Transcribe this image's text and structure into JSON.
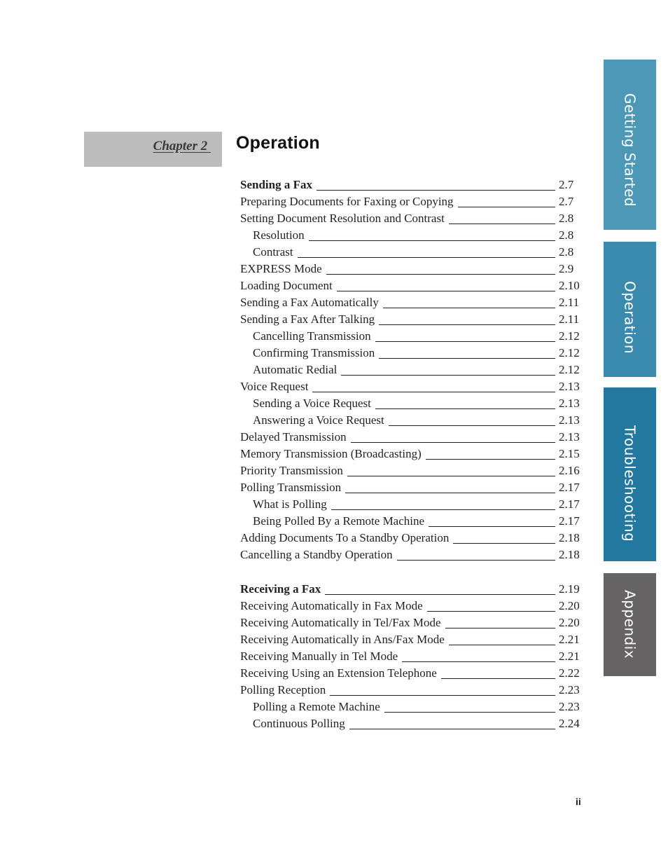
{
  "chapter": {
    "label": "Chapter 2 ",
    "title": "Operation"
  },
  "toc": [
    {
      "text": "Sending a Fax",
      "page": "2.7",
      "level": 0,
      "bold": true
    },
    {
      "text": "Preparing Documents for Faxing or Copying",
      "page": "2.7",
      "level": 0,
      "bold": false
    },
    {
      "text": "Setting Document Resolution and Contrast",
      "page": "2.8",
      "level": 0,
      "bold": false
    },
    {
      "text": "Resolution",
      "page": "2.8",
      "level": 1,
      "bold": false
    },
    {
      "text": "Contrast",
      "page": "2.8",
      "level": 1,
      "bold": false
    },
    {
      "text": "EXPRESS Mode",
      "page": "2.9",
      "level": 0,
      "bold": false
    },
    {
      "text": "Loading Document",
      "page": "2.10",
      "level": 0,
      "bold": false
    },
    {
      "text": "Sending a Fax Automatically",
      "page": "2.11",
      "level": 0,
      "bold": false
    },
    {
      "text": "Sending a Fax After Talking",
      "page": "2.11",
      "level": 0,
      "bold": false
    },
    {
      "text": "Cancelling Transmission",
      "page": "2.12",
      "level": 1,
      "bold": false
    },
    {
      "text": "Confirming Transmission",
      "page": "2.12",
      "level": 1,
      "bold": false
    },
    {
      "text": "Automatic Redial",
      "page": "2.12",
      "level": 1,
      "bold": false
    },
    {
      "text": "Voice Request",
      "page": "2.13",
      "level": 0,
      "bold": false
    },
    {
      "text": "Sending a Voice Request",
      "page": "2.13",
      "level": 1,
      "bold": false
    },
    {
      "text": "Answering a Voice Request",
      "page": "2.13",
      "level": 1,
      "bold": false
    },
    {
      "text": "Delayed Transmission",
      "page": "2.13",
      "level": 0,
      "bold": false
    },
    {
      "text": "Memory Transmission (Broadcasting)",
      "page": "2.15",
      "level": 0,
      "bold": false
    },
    {
      "text": "Priority Transmission",
      "page": "2.16",
      "level": 0,
      "bold": false
    },
    {
      "text": "Polling Transmission",
      "page": "2.17",
      "level": 0,
      "bold": false
    },
    {
      "text": "What is Polling",
      "page": "2.17",
      "level": 1,
      "bold": false
    },
    {
      "text": "Being Polled By a Remote Machine",
      "page": "2.17",
      "level": 1,
      "bold": false
    },
    {
      "text": "Adding Documents To a Standby Operation",
      "page": "2.18",
      "level": 0,
      "bold": false
    },
    {
      "text": "Cancelling a Standby Operation",
      "page": "2.18",
      "level": 0,
      "bold": false
    },
    {
      "gap": true
    },
    {
      "text": "Receiving a Fax",
      "page": "2.19",
      "level": 0,
      "bold": true
    },
    {
      "text": "Receiving Automatically in Fax Mode",
      "page": "2.20",
      "level": 0,
      "bold": false
    },
    {
      "text": "Receiving Automatically in Tel/Fax Mode",
      "page": "2.20",
      "level": 0,
      "bold": false
    },
    {
      "text": "Receiving Automatically in Ans/Fax Mode",
      "page": "2.21",
      "level": 0,
      "bold": false
    },
    {
      "text": "Receiving Manually in Tel Mode",
      "page": "2.21",
      "level": 0,
      "bold": false
    },
    {
      "text": "Receiving Using an Extension Telephone",
      "page": "2.22",
      "level": 0,
      "bold": false
    },
    {
      "text": "Polling Reception",
      "page": "2.23",
      "level": 0,
      "bold": false
    },
    {
      "text": "Polling a Remote Machine",
      "page": "2.23",
      "level": 1,
      "bold": false
    },
    {
      "text": "Continuous Polling",
      "page": "2.24",
      "level": 1,
      "bold": false
    }
  ],
  "side_tabs": [
    {
      "label": "Getting Started",
      "color": "#4d98b6"
    },
    {
      "label": "Operation",
      "color": "#3a8aae"
    },
    {
      "label": "Troubleshooting",
      "color": "#22789e"
    },
    {
      "label": "Appendix",
      "color": "#656363"
    }
  ],
  "footer": {
    "page_number": "ii"
  }
}
